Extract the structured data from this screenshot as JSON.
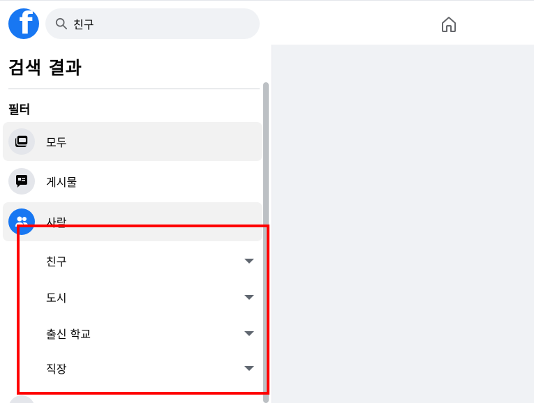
{
  "header": {
    "logo_letter": "f",
    "search": {
      "value": "친구",
      "icon": "search-icon"
    },
    "home_icon": "home-icon"
  },
  "sidebar": {
    "title": "검색 결과",
    "filter_title": "필터",
    "items": [
      {
        "label": "모두",
        "icon": "all-results-icon",
        "active": true
      },
      {
        "label": "게시물",
        "icon": "posts-icon",
        "active": false
      },
      {
        "label": "사람",
        "icon": "people-icon",
        "active": true
      }
    ],
    "people_filters": [
      {
        "label": "친구"
      },
      {
        "label": "도시"
      },
      {
        "label": "출신 학교"
      },
      {
        "label": "직장"
      }
    ]
  },
  "colors": {
    "brand": "#1877f2",
    "highlight": "#ff0000",
    "main_bg": "#f0f2f5"
  }
}
